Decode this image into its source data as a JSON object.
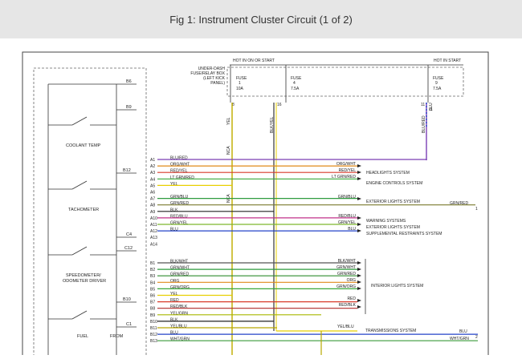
{
  "title": "Fig 1: Instrument Cluster Circuit (1 of 2)",
  "header": {
    "hot_in_on_or_start": "HOT IN ON OR START",
    "hot_in_start": "HOT IN START",
    "under_dash_1": "UNDER-DASH",
    "under_dash_2": "FUSE/RELAY BOX",
    "under_dash_3": "(LEFT KICK",
    "under_dash_4": "PANEL)",
    "fuse1_name": "FUSE",
    "fuse1_num": "1",
    "fuse1_amp": "10A",
    "fuse2_name": "FUSE",
    "fuse2_num": "4",
    "fuse2_amp": "7.5A",
    "fuse3_name": "FUSE",
    "fuse3_num": "9",
    "fuse3_amp": "7.5A",
    "fuse1_pin": "8",
    "fuse2_pin": "16",
    "fuse3_pin": "11",
    "fuse3_sub": "1"
  },
  "cluster": {
    "coolant": "COOLANT TEMP",
    "tach": "TACHOMETER",
    "speedo_1": "SPEEDOMETER/",
    "speedo_2": "ODOMETER DRIVER",
    "fuel": "FUEL",
    "from": "FROM",
    "pin_b6": "B6",
    "pin_b9": "B9",
    "pin_b12": "B12",
    "pin_c4": "C4",
    "pin_c12": "C12",
    "pin_b10": "B10",
    "pin_c1": "C1"
  },
  "vertical_labels": {
    "yel": "YEL",
    "blk_yel": "BLK/YEL",
    "blu_red": "BLU/RED",
    "nca_1": "NCA",
    "nca_2": "NCA",
    "blu": "BLU"
  },
  "connector_a": [
    {
      "pin": "A1",
      "wire": "BLU/RED",
      "color": "#7b3fb5"
    },
    {
      "pin": "A2",
      "wire": "ORG/WHT",
      "color": "#e08a1a"
    },
    {
      "pin": "A3",
      "wire": "RED/YEL",
      "color": "#d93a2a"
    },
    {
      "pin": "A4",
      "wire": "LT GRN/RED",
      "color": "#3aa83a"
    },
    {
      "pin": "A5",
      "wire": "YEL",
      "color": "#e8cf00"
    },
    {
      "pin": "A6",
      "wire": "",
      "color": ""
    },
    {
      "pin": "A7",
      "wire": "GRN/BLU",
      "color": "#2e9b3e"
    },
    {
      "pin": "A8",
      "wire": "GRN/RED",
      "color": "#7a7a2e"
    },
    {
      "pin": "A9",
      "wire": "BLK",
      "color": "#222222"
    },
    {
      "pin": "A10",
      "wire": "RED/BLU",
      "color": "#c0328a"
    },
    {
      "pin": "A11",
      "wire": "GRN/YEL",
      "color": "#7db62e"
    },
    {
      "pin": "A12",
      "wire": "BLU",
      "color": "#2343c8"
    },
    {
      "pin": "A13",
      "wire": "",
      "color": ""
    },
    {
      "pin": "A14",
      "wire": "",
      "color": ""
    }
  ],
  "right_a": [
    {
      "wire": "ORG/WHT"
    },
    {
      "wire": "RED/YEL"
    },
    {
      "wire": "LT GRN/RED"
    },
    {
      "wire": "GRN/BLU"
    },
    {
      "wire": "RED/BLU"
    },
    {
      "wire": "GRN/YEL"
    },
    {
      "wire": "BLU"
    }
  ],
  "systems_a": [
    "HEADLIGHTS SYSTEM",
    "ENGINE CONTROLS SYSTEM",
    "EXTERIOR LIGHTS SYSTEM",
    "WARNING SYSTEMS",
    "EXTERIOR LIGHTS SYSTEM",
    "SUPPLEMENTAL RESTRAINTS SYSTEM"
  ],
  "grn_red_right": "GRN/RED",
  "offpage_1": "1",
  "offpage_2": "2",
  "connector_b": [
    {
      "pin": "B1",
      "wire": "BLK/WHT",
      "color": "#555555"
    },
    {
      "pin": "B2",
      "wire": "GRN/WHT",
      "color": "#2e9b3e"
    },
    {
      "pin": "B3",
      "wire": "GRN/RED",
      "color": "#2e8b2e"
    },
    {
      "pin": "B4",
      "wire": "ORG",
      "color": "#e08a1a"
    },
    {
      "pin": "B5",
      "wire": "GRN/ORG",
      "color": "#3aa83a"
    },
    {
      "pin": "B6",
      "wire": "YEL",
      "color": "#e8cf00"
    },
    {
      "pin": "B7",
      "wire": "RED",
      "color": "#d93a2a"
    },
    {
      "pin": "B8",
      "wire": "RED/BLK",
      "color": "#b02a2a"
    },
    {
      "pin": "B9",
      "wire": "YEL/GRN",
      "color": "#a8b800"
    },
    {
      "pin": "B10",
      "wire": "BLK",
      "color": "#222222"
    },
    {
      "pin": "B11",
      "wire": "YEL/BLU",
      "color": "#b8a800"
    },
    {
      "pin": "B12",
      "wire": "BLU",
      "color": "#2343c8"
    },
    {
      "pin": "B13",
      "wire": "WHT/GRN",
      "color": "#3a9a3a"
    }
  ],
  "right_b": [
    {
      "wire": "BLK/WHT"
    },
    {
      "wire": "GRN/WHT"
    },
    {
      "wire": "GRN/RED"
    },
    {
      "wire": "ORG"
    },
    {
      "wire": "GRN/ORG"
    },
    {
      "wire": "RED"
    },
    {
      "wire": "RED/BLK"
    }
  ],
  "interior": "INTERIOR LIGHTS SYSTEM",
  "trans_wire": "YEL/BLU",
  "trans": "TRANSMISSIONS SYSTEM",
  "blu_right": "BLU",
  "wht_grn_right": "WHT/GRN"
}
